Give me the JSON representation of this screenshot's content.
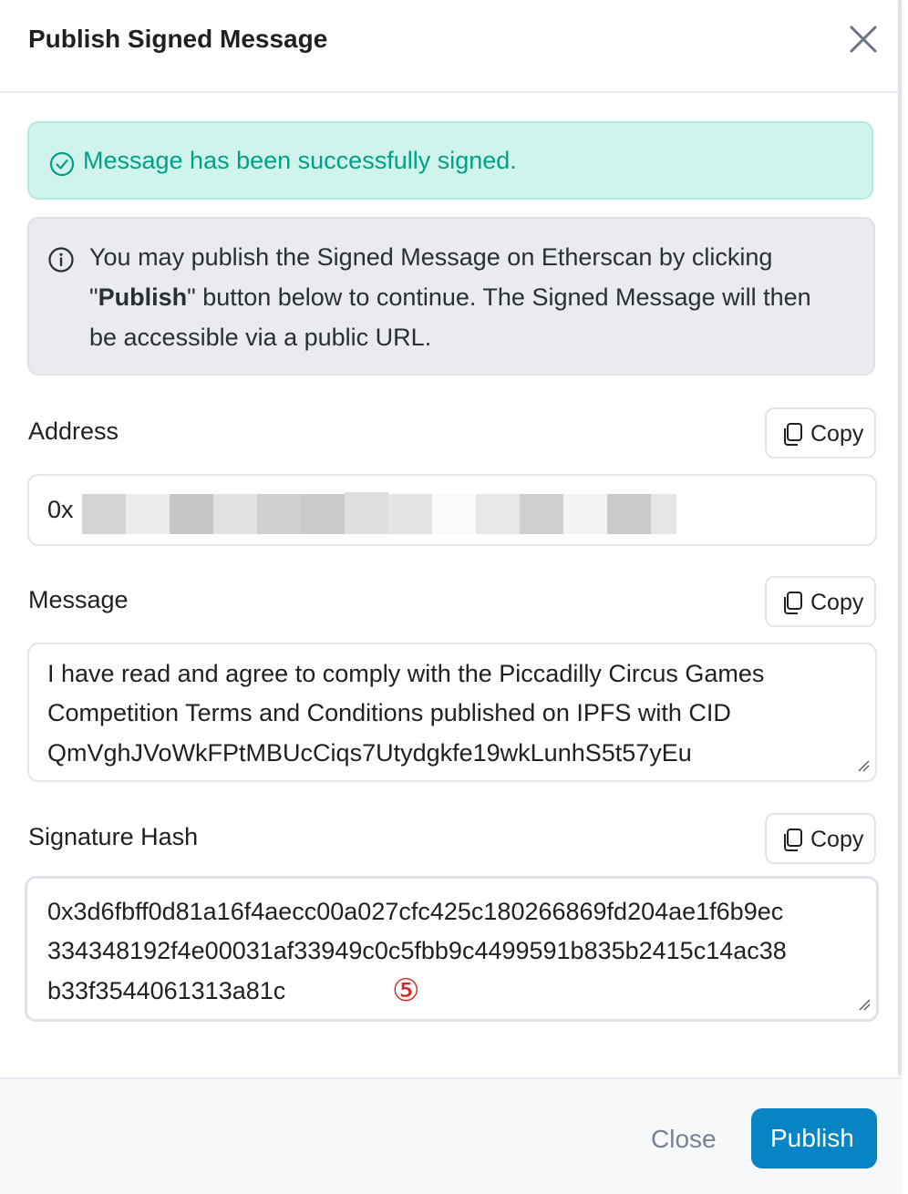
{
  "dialog": {
    "title": "Publish Signed Message"
  },
  "alerts": {
    "success_text": "Message has been successfully signed.",
    "info_line1": " You may publish the Signed Message on Etherscan by clicking",
    "info_line2_open": "\"",
    "info_line2_bold": "Publish",
    "info_line2_rest": "\" button below to continue. The Signed Message will then",
    "info_line3": "be accessible via a public URL."
  },
  "fields": {
    "address": {
      "label": "Address",
      "value_prefix": "0x",
      "copy_label": "Copy"
    },
    "message": {
      "label": "Message",
      "lines": [
        "I have read and agree to comply with the Piccadilly Circus Games",
        "Competition Terms and Conditions published on IPFS with CID",
        "QmVghJVoWkFPtMBUcCiqs7Utydgkfe19wkLunhS5t57yEu"
      ],
      "copy_label": "Copy"
    },
    "signature": {
      "label": "Signature Hash",
      "lines": [
        "0x3d6fbff0d81a16f4aecc00a027cfc425c180266869fd204ae1f6b9ec",
        "334348192f4e00031af33949c0c5fbb9c4499591b835b2415c14ac38",
        "b33f3544061313a81c"
      ],
      "copy_label": "Copy"
    }
  },
  "footer": {
    "close_label": "Close",
    "publish_label": "Publish"
  },
  "annotation": {
    "marker": "⑤"
  },
  "colors": {
    "accent": "#0784c3",
    "success_bg": "#cff4ec",
    "success_text": "#00a186",
    "info_bg": "#e9ebef"
  },
  "icons": [
    "close-icon",
    "check-circle-icon",
    "info-circle-icon",
    "copy-icon",
    "resize-grip-icon"
  ]
}
